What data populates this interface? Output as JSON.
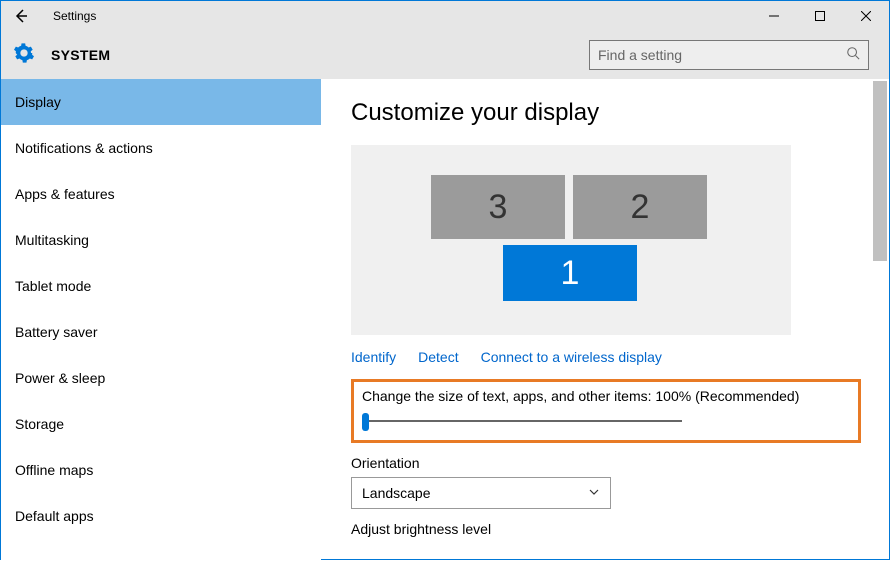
{
  "window": {
    "title": "Settings"
  },
  "header": {
    "section": "SYSTEM"
  },
  "search": {
    "placeholder": "Find a setting"
  },
  "sidebar": {
    "items": [
      "Display",
      "Notifications & actions",
      "Apps & features",
      "Multitasking",
      "Tablet mode",
      "Battery saver",
      "Power & sleep",
      "Storage",
      "Offline maps",
      "Default apps"
    ],
    "active_index": 0
  },
  "page": {
    "title": "Customize your display",
    "monitors": {
      "m1": "1",
      "m2": "2",
      "m3": "3"
    },
    "links": {
      "identify": "Identify",
      "detect": "Detect",
      "connect": "Connect to a wireless display"
    },
    "scale_label": "Change the size of text, apps, and other items: 100% (Recommended)",
    "orientation_label": "Orientation",
    "orientation_value": "Landscape",
    "brightness_label": "Adjust brightness level"
  }
}
